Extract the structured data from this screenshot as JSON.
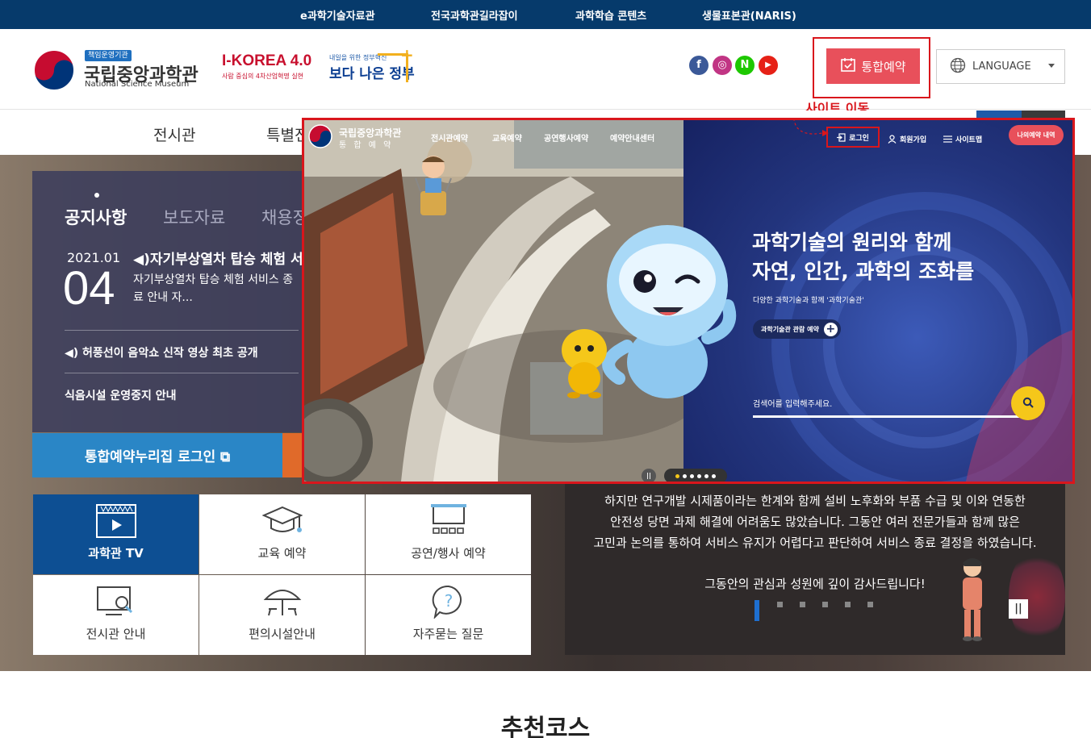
{
  "topbar": {
    "links": [
      "e과학기술자료관",
      "전국과학관길라잡이",
      "과학학습 콘텐츠",
      "생물표본관(NARIS)"
    ]
  },
  "header": {
    "logo_badge": "책임운영기관",
    "logo_kr": "국립중앙과학관",
    "logo_en": "National Science Museum",
    "ikorea_title": "I-KOREA 4.0",
    "ikorea_sub": "사람 중심의 4차산업혁명 실현",
    "gov_sub": "내일을 위한 정부혁신",
    "gov_title": "보다 나은 정부",
    "sns": [
      "f",
      "◎",
      "N",
      "▶"
    ],
    "reserve_btn": "통합예약",
    "language_btn": "LANGUAGE",
    "annotation": "사이트 이동"
  },
  "nav": {
    "items": [
      "전시관",
      "특별전"
    ]
  },
  "notice": {
    "tabs": [
      "공지사항",
      "보도자료",
      "채용정"
    ],
    "date_ym": "2021.01",
    "date_d": "04",
    "top_title": "◀)자기부상열차 탑승 체험 서",
    "top_desc": "자기부상열차 탑승 체험 서비스 종료 안내 자...",
    "items": [
      "◀) 허풍선이 음악쇼 신작 영상 최초 공개",
      "식음시설 운영중지 안내"
    ]
  },
  "login_btn": "통합예약누리집 로그인 ⧉",
  "quick": [
    {
      "label": "과학관 TV",
      "icon": "video-icon",
      "active": true
    },
    {
      "label": "교육 예약",
      "icon": "graduation-cap-icon"
    },
    {
      "label": "공연/행사 예약",
      "icon": "stage-icon"
    },
    {
      "label": "전시관 안내",
      "icon": "monitor-search-icon"
    },
    {
      "label": "편의시설안내",
      "icon": "parasol-icon"
    },
    {
      "label": "자주묻는 질문",
      "icon": "question-bubble-icon"
    }
  ],
  "popup": {
    "logo_main": "국립중앙과학관",
    "logo_sub": "통 합 예 약",
    "menu": [
      "전시관예약",
      "교육예약",
      "공연행사예약",
      "예약안내센터"
    ],
    "login": "로그인",
    "signup": "회원가입",
    "sitemap": "사이트맵",
    "myres": "나의예약 내역",
    "headline1": "과학기술의 원리와 함께",
    "headline2": "자연, 인간, 과학의 조화를",
    "subline": "다양한 과학기술과 함께 '과학기술관'",
    "pill": "과학기술관 관람 예약",
    "search_placeholder": "검색어를 입력해주세요."
  },
  "notice_text": {
    "line1": "하지만 연구개발 시제품이라는 한계와 함께 설비 노후화와 부품 수급 및 이와 연동한",
    "line2": "안전성 당면 과제 해결에 어려움도 많았습니다. 그동안 여러 전문가들과 함께 많은",
    "line3": "고민과 논의를 통하여 서비스 유지가 어렵다고 판단하여 서비스 종료 결정을 하였습니다.",
    "line4": "그동안의 관심과 성원에 깊이 감사드립니다!",
    "pause": "||"
  },
  "section_title": "추천코스",
  "colors": {
    "navy": "#063a6b",
    "accent_red": "#e8505b",
    "highlight": "#d9161c",
    "tv_blue": "#0d4f93"
  }
}
